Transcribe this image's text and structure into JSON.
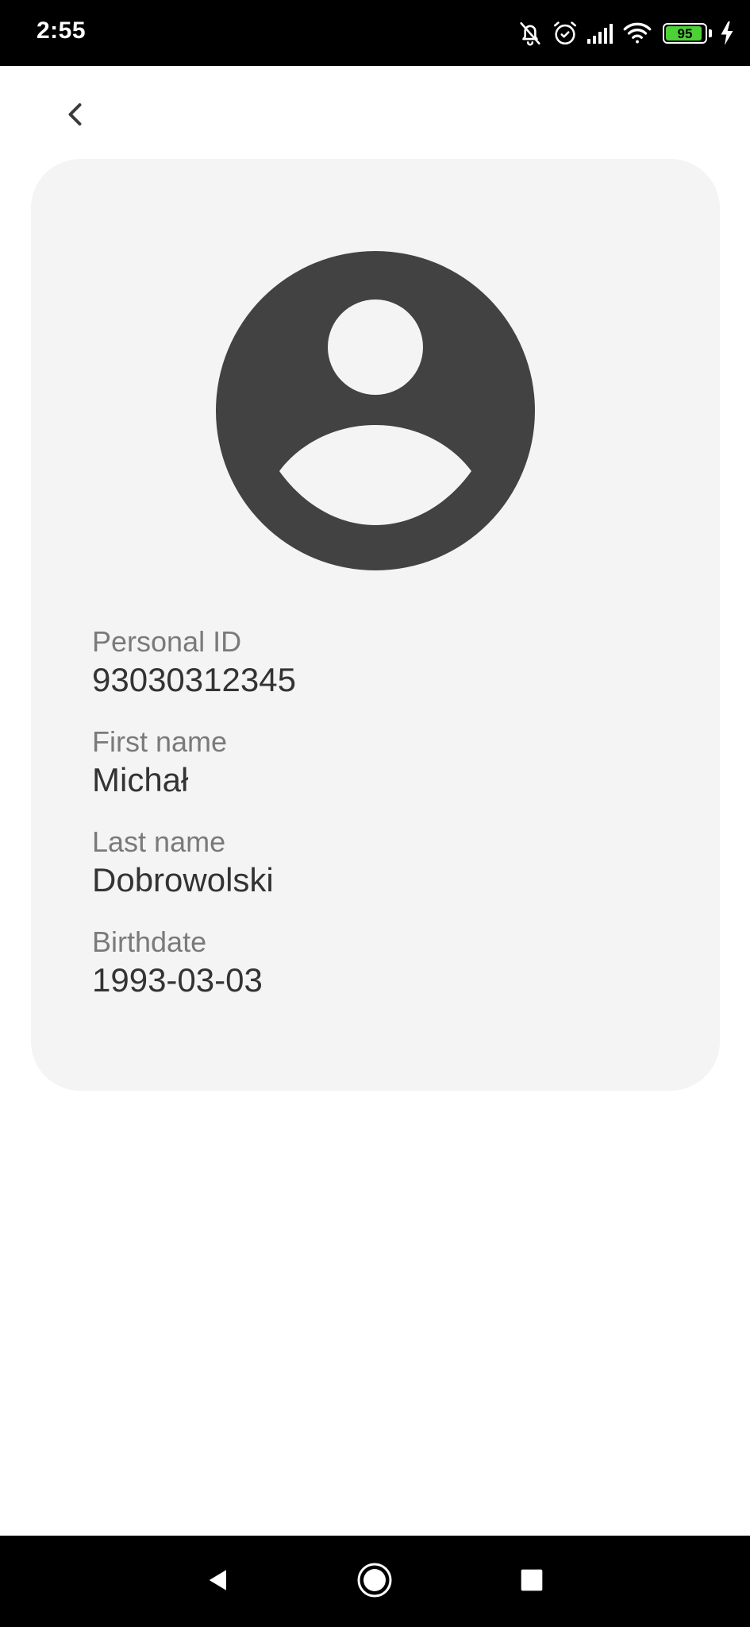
{
  "status_bar": {
    "time": "2:55",
    "battery_level": "95",
    "battery_fraction": 0.95,
    "icons": [
      "notifications-off-icon",
      "alarm-icon",
      "signal-icon",
      "wifi-icon",
      "battery-icon",
      "charging-icon"
    ]
  },
  "header": {
    "back_icon": "chevron-left-icon"
  },
  "profile": {
    "avatar_icon": "account-circle-icon",
    "fields": [
      {
        "label": "Personal ID",
        "value": "93030312345"
      },
      {
        "label": "First name",
        "value": "Michał"
      },
      {
        "label": "Last name",
        "value": "Dobrowolski"
      },
      {
        "label": "Birthdate",
        "value": "1993-03-03"
      }
    ]
  },
  "nav_bar": {
    "icons": [
      "back-triangle-icon",
      "home-circle-icon",
      "recents-square-icon"
    ]
  },
  "colors": {
    "card_background": "#f4f4f4",
    "avatar": "#424242",
    "label": "#7a7a7a",
    "value": "#333333",
    "battery": "#4cd137"
  }
}
